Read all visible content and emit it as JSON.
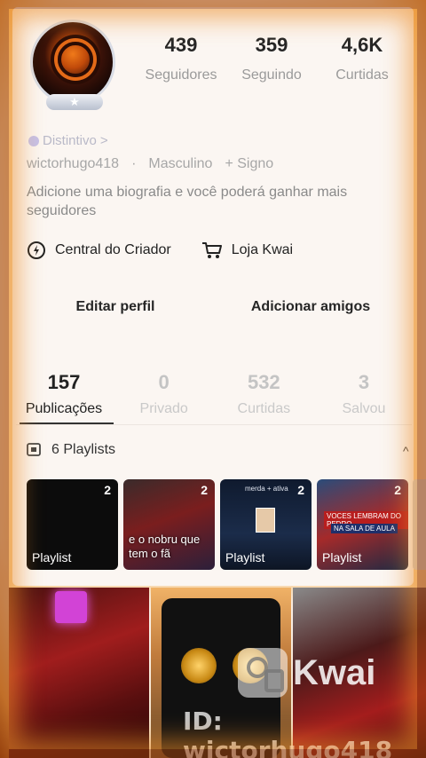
{
  "profile": {
    "stats": [
      {
        "value": "439",
        "label": "Seguidores"
      },
      {
        "value": "359",
        "label": "Seguindo"
      },
      {
        "value": "4,6K",
        "label": "Curtidas"
      }
    ],
    "badge_label": "Distintivo",
    "badge_chevron": ">",
    "username": "wictorhugo418",
    "separator": "·",
    "gender": "Masculino",
    "sign": "+ Signo",
    "bio": "Adicione uma biografia e você poderá ganhar mais seguidores",
    "avatar_badge": "★"
  },
  "tools": {
    "creator_center": "Central do Criador",
    "shop": "Loja Kwai"
  },
  "actions": {
    "edit_profile": "Editar perfil",
    "add_friends": "Adicionar amigos"
  },
  "tabs": [
    {
      "value": "157",
      "label": "Publicações",
      "active": true
    },
    {
      "value": "0",
      "label": "Privado",
      "active": false
    },
    {
      "value": "532",
      "label": "Curtidas",
      "active": false
    },
    {
      "value": "3",
      "label": "Salvou",
      "active": false
    }
  ],
  "playlists": {
    "header": "6 Playlists",
    "chevron": "^",
    "cards": [
      {
        "count": "2",
        "title": "Playlist",
        "caption": ""
      },
      {
        "count": "2",
        "title": "",
        "caption": "e o nobru que tem o fã"
      },
      {
        "count": "2",
        "title": "Playlist",
        "caption": ""
      },
      {
        "count": "2",
        "title": "Playlist",
        "caption": ""
      }
    ],
    "card3_top_text": "merda + ativa",
    "card4_tag1": "VOCES LEMBRAM DO PEDRO",
    "card4_tag2": "NA SALA DE AULA"
  },
  "watermark": {
    "brand": "Kwai",
    "id": "ID: wictorhugo418"
  },
  "colors": {
    "frame_glow": "#e9a24a",
    "sheet": "#fbf6f2",
    "text_dark": "#262626",
    "text_muted": "#9a9a9a"
  }
}
